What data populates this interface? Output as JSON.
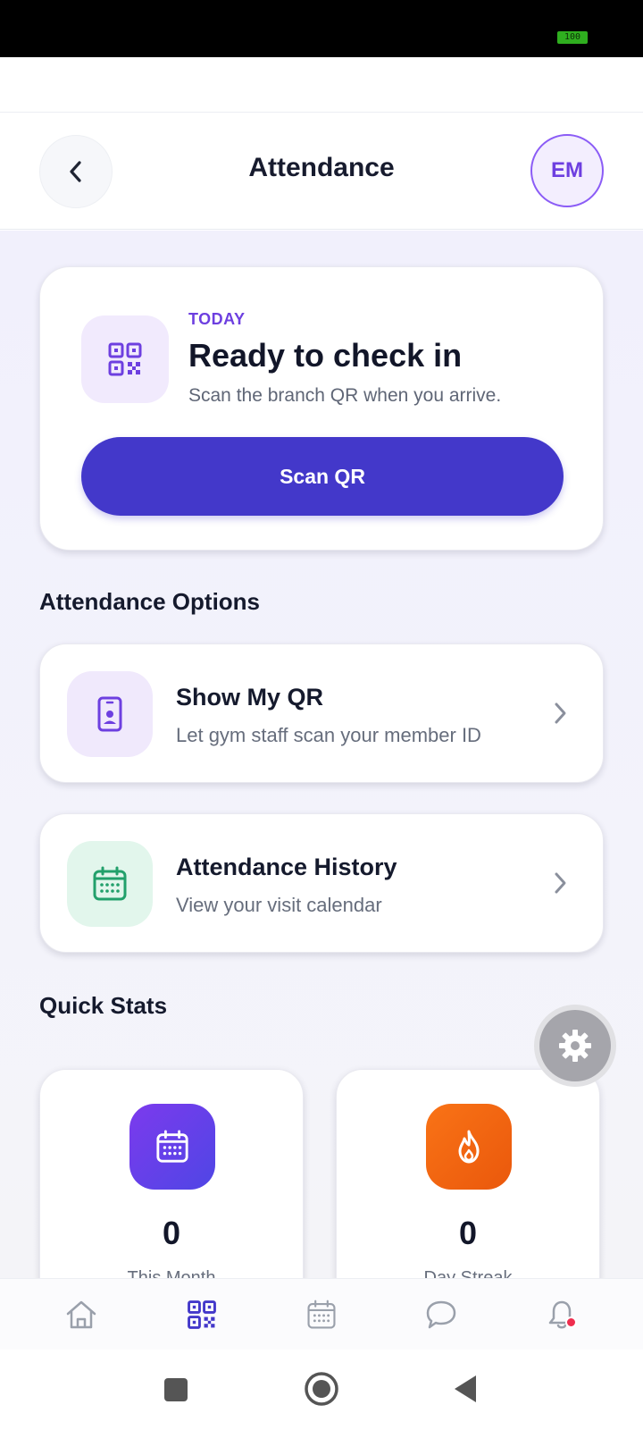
{
  "status_bar": {
    "battery": "100"
  },
  "header": {
    "title": "Attendance",
    "avatar_initials": "EM"
  },
  "checkin": {
    "eyebrow": "TODAY",
    "title": "Ready to check in",
    "subtitle": "Scan the branch QR when you arrive.",
    "button_label": "Scan QR"
  },
  "options": {
    "section_title": "Attendance Options",
    "items": [
      {
        "title": "Show My QR",
        "subtitle": "Let gym staff scan your member ID",
        "icon": "phone-id-icon"
      },
      {
        "title": "Attendance History",
        "subtitle": "View your visit calendar",
        "icon": "calendar-icon"
      }
    ]
  },
  "stats": {
    "section_title": "Quick Stats",
    "items": [
      {
        "value": "0",
        "label": "This Month",
        "icon": "calendar-icon"
      },
      {
        "value": "0",
        "label": "Day Streak",
        "icon": "flame-icon"
      }
    ]
  },
  "bottom_nav": {
    "items": [
      "home-icon",
      "qr-icon",
      "calendar-icon",
      "chat-icon",
      "bell-icon"
    ],
    "active": "qr-icon"
  },
  "colors": {
    "primary": "#4338ca",
    "accent_purple": "#6d3fe0",
    "green_tile": "#e2f6ec",
    "orange": "#f97316",
    "notification": "#ef2d4e"
  }
}
